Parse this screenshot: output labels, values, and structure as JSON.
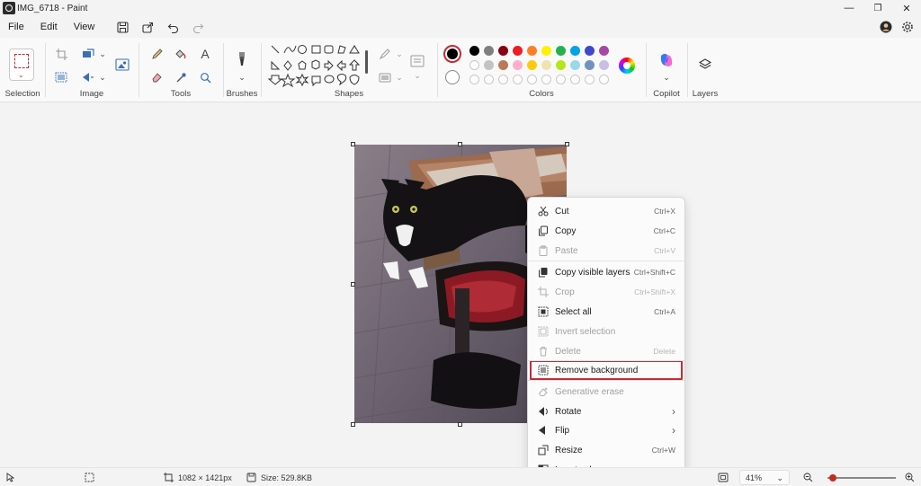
{
  "window": {
    "title": "IMG_6718 - Paint",
    "minimize": "—",
    "maximize": "❐",
    "close": "✕"
  },
  "menu": {
    "items": [
      {
        "label": "File"
      },
      {
        "label": "Edit"
      },
      {
        "label": "View"
      }
    ]
  },
  "ribbon": {
    "groups": {
      "selection": "Selection",
      "image": "Image",
      "tools": "Tools",
      "brushes": "Brushes",
      "shapes": "Shapes",
      "colors": "Colors",
      "copilot": "Copilot",
      "layers": "Layers"
    },
    "tools_text_icon": "A",
    "palette": {
      "row1": [
        "#000000",
        "#7f7f7f",
        "#880015",
        "#ed1c24",
        "#ff7f27",
        "#fff200",
        "#22b14c",
        "#00a2e8",
        "#3f48cc",
        "#a349a4"
      ],
      "row2": [
        "#ffffff",
        "#c3c3c3",
        "#b97a57",
        "#ffaec9",
        "#ffc90e",
        "#efe4b0",
        "#b5e61d",
        "#99d9ea",
        "#7092be",
        "#c8bfe7"
      ]
    }
  },
  "context_menu": {
    "items": [
      {
        "label": "Cut",
        "shortcut": "Ctrl+X",
        "icon": "scissors-icon",
        "disabled": false
      },
      {
        "label": "Copy",
        "shortcut": "Ctrl+C",
        "icon": "copy-icon",
        "disabled": false
      },
      {
        "label": "Paste",
        "shortcut": "Ctrl+V",
        "icon": "paste-icon",
        "disabled": true
      },
      {
        "label": "Copy visible layers",
        "shortcut": "Ctrl+Shift+C",
        "icon": "copy-layers-icon",
        "disabled": false
      },
      {
        "label": "Crop",
        "shortcut": "Ctrl+Shift+X",
        "icon": "crop-icon",
        "disabled": true
      },
      {
        "label": "Select all",
        "shortcut": "Ctrl+A",
        "icon": "select-all-icon",
        "disabled": false
      },
      {
        "label": "Invert selection",
        "shortcut": "",
        "icon": "invert-selection-icon",
        "disabled": true
      },
      {
        "label": "Delete",
        "shortcut": "Delete",
        "icon": "trash-icon",
        "disabled": true
      },
      {
        "label": "Remove background",
        "shortcut": "",
        "icon": "remove-background-icon",
        "disabled": false,
        "highlighted": true
      },
      {
        "label": "Generative erase",
        "shortcut": "",
        "icon": "generative-erase-icon",
        "disabled": true
      },
      {
        "label": "Rotate",
        "shortcut": "›",
        "icon": "rotate-icon",
        "disabled": false
      },
      {
        "label": "Flip",
        "shortcut": "›",
        "icon": "flip-icon",
        "disabled": false
      },
      {
        "label": "Resize",
        "shortcut": "Ctrl+W",
        "icon": "resize-icon",
        "disabled": false
      },
      {
        "label": "Invert color",
        "shortcut": "Ctrl+Shift+I",
        "icon": "invert-color-icon",
        "disabled": false
      }
    ]
  },
  "status": {
    "dimensions": "1082 × 1421px",
    "size": "Size: 529.8KB",
    "zoom": "41%",
    "zoom_chevron": "⌄",
    "zoom_out": "−",
    "zoom_in": "+",
    "zoom_slider_fraction": 0.08
  },
  "colors": {
    "accent_red": "#c42b34",
    "slider_thumb": "#c42b1c"
  }
}
